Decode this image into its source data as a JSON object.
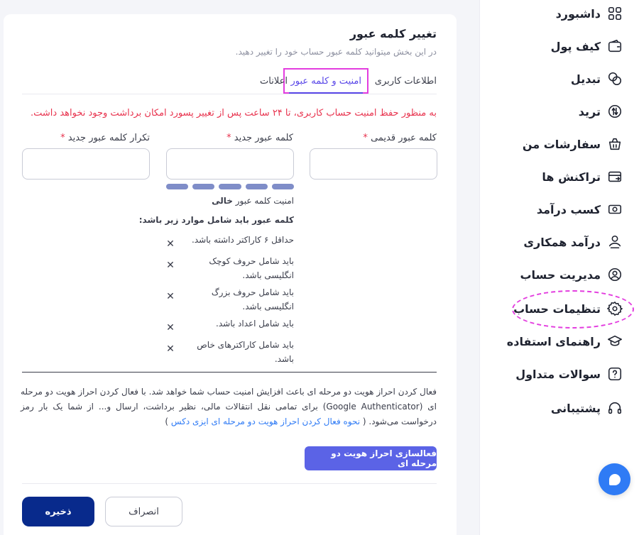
{
  "sidebar": {
    "items": [
      {
        "label": "داشبورد",
        "icon": "dashboard-icon"
      },
      {
        "label": "کیف پول",
        "icon": "wallet-icon"
      },
      {
        "label": "تبدیل",
        "icon": "exchange-icon"
      },
      {
        "label": "ترید",
        "icon": "trade-icon"
      },
      {
        "label": "سفارشات من",
        "icon": "orders-icon"
      },
      {
        "label": "تراکنش ها",
        "icon": "transactions-icon"
      },
      {
        "label": "کسب درآمد",
        "icon": "earn-icon"
      },
      {
        "label": "درآمد همکاری",
        "icon": "referral-icon"
      },
      {
        "label": "مدیریت حساب",
        "icon": "user-icon"
      },
      {
        "label": "تنظیمات حساب",
        "icon": "gear-icon",
        "active": true
      },
      {
        "label": "راهنمای استفاده",
        "icon": "graduation-cap-icon"
      },
      {
        "label": "سوالات متداول",
        "icon": "question-icon"
      },
      {
        "label": "پشتیبانی",
        "icon": "headphones-icon"
      }
    ]
  },
  "page": {
    "title": "تغییر کلمه عبور",
    "subtitle": "در این بخش میتوانید کلمه عبور حساب خود را تغییر دهید."
  },
  "tabs": {
    "user_info": "اطلاعات کاربری",
    "security": "امنیت و کلمه عبور",
    "notifications": "اعلانات",
    "active": "security"
  },
  "form": {
    "warning": "به منظور حفظ امنیت حساب کاربری، تا ۲۴ ساعت پس از تغییر پسورد امکان برداشت وجود نخواهد داشت.",
    "old_password_label": "کلمه عبور قدیمی",
    "new_password_label": "کلمه عبور جدید",
    "repeat_password_label": "تکرار کلمه عبور جدید",
    "required_mark": "*",
    "old_password_value": "",
    "new_password_value": "",
    "repeat_password_value": "",
    "strength_prefix": "امنیت کلمه عبور",
    "strength_value": "خالی",
    "requirements_title": "کلمه عبور باید شامل موارد زیر باشد:",
    "requirements": [
      "حداقل ۶ کاراکتر داشته باشد.",
      "باید شامل حروف کوچک انگلیسی باشد.",
      "باید شامل حروف بزرگ انگلیسی باشد.",
      "باید شامل اعداد باشد.",
      "باید شامل کاراکترهای خاص باشد."
    ]
  },
  "twofa": {
    "text": "فعال کردن احراز هویت دو مرحله ای باعث افزایش امنیت حساب شما خواهد شد. با فعال کردن احراز هویت دو مرحله ای (Google Authenticator) برای تمامی نقل انتقالات مالی، نظیر برداشت، ارسال و... از شما یک بار رمز درخواست می‌شود. (",
    "link": "نحوه فعال کردن احراز هویت دو مرحله ای ایزی دکس",
    "text_end": ")",
    "button": "فعالسازی احراز هویت دو مرحله ای"
  },
  "actions": {
    "cancel": "انصراف",
    "save": "ذخیره"
  },
  "colors": {
    "primary": "#082a8c",
    "accent": "#5b63e6",
    "warning": "#e8334e",
    "link": "#2f7bf5",
    "highlight": "#e33ddf"
  }
}
